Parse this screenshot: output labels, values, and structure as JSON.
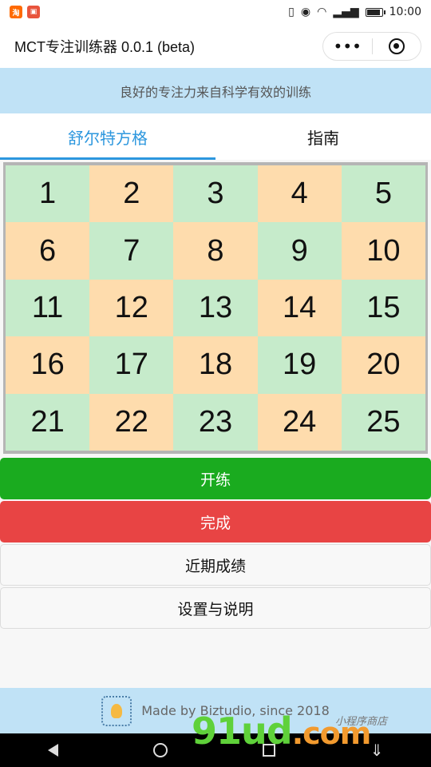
{
  "status_bar": {
    "time": "10:00",
    "app_badge_1": "淘",
    "app_badge_2": "",
    "app_badge_1_color": "#ff6a00",
    "app_badge_2_color": "#e8543c"
  },
  "title_bar": {
    "title": "MCT专注训练器 0.0.1 (beta)",
    "more_label": "•••"
  },
  "banner": {
    "text": "良好的专注力来自科学有效的训练"
  },
  "tabs": [
    {
      "label": "舒尔特方格",
      "active": true
    },
    {
      "label": "指南",
      "active": false
    }
  ],
  "grid": {
    "cells": [
      "1",
      "2",
      "3",
      "4",
      "5",
      "6",
      "7",
      "8",
      "9",
      "10",
      "11",
      "12",
      "13",
      "14",
      "15",
      "16",
      "17",
      "18",
      "19",
      "20",
      "21",
      "22",
      "23",
      "24",
      "25"
    ],
    "colors": {
      "green": "#c6ebcb",
      "orange": "#fedcad"
    }
  },
  "buttons": {
    "start": "开练",
    "done": "完成",
    "scores": "近期成绩",
    "settings": "设置与说明"
  },
  "footer": {
    "text": "Made by Biztudio, since 2018"
  },
  "watermark": {
    "main": "91ud",
    "suffix": ".com",
    "cn": "小程序商店"
  },
  "colors": {
    "accent": "#2c97de",
    "start": "#1aab1f",
    "done": "#e84444",
    "banner": "#c0e2f6"
  }
}
